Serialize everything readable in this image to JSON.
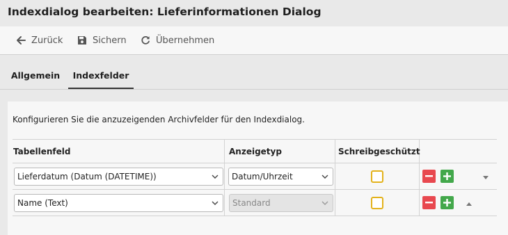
{
  "window": {
    "title": "Indexdialog bearbeiten: Lieferinformationen Dialog"
  },
  "toolbar": {
    "back_label": "Zurück",
    "save_label": "Sichern",
    "apply_label": "Übernehmen"
  },
  "tabs": [
    {
      "label": "Allgemein",
      "active": false
    },
    {
      "label": "Indexfelder",
      "active": true
    }
  ],
  "main": {
    "description": "Konfigurieren Sie die anzuzeigenden Archivfelder für den Indexdialog.",
    "columns": [
      "Tabellenfeld",
      "Anzeigetyp",
      "Schreibgeschützt"
    ],
    "rows": [
      {
        "field": "Lieferdatum (Datum (DATETIME))",
        "display_type": "Datum/Uhrzeit",
        "display_type_disabled": false,
        "readonly": false,
        "move": "down"
      },
      {
        "field": "Name (Text)",
        "display_type": "Standard",
        "display_type_disabled": true,
        "readonly": false,
        "move": "up"
      }
    ]
  },
  "colors": {
    "checkbox_border": "#e3b21b",
    "remove_button": "#e8484f",
    "add_button": "#43a84b"
  }
}
